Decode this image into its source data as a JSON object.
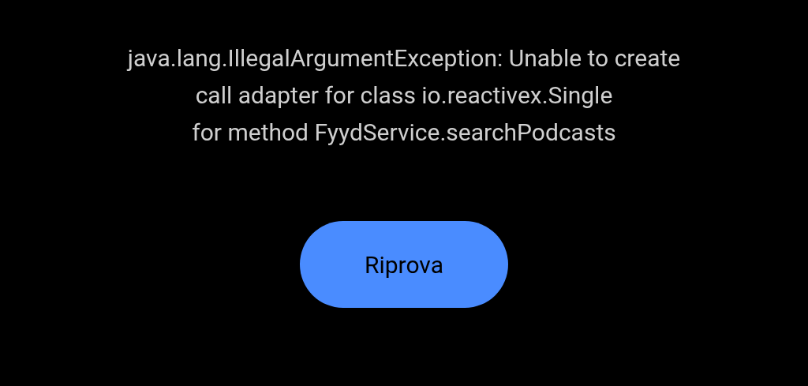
{
  "error": {
    "message": "java.lang.IllegalArgumentException: Unable to create\ncall adapter for class io.reactivex.Single\n for method FyydService.searchPodcasts"
  },
  "retry_button": {
    "label": "Riprova"
  }
}
